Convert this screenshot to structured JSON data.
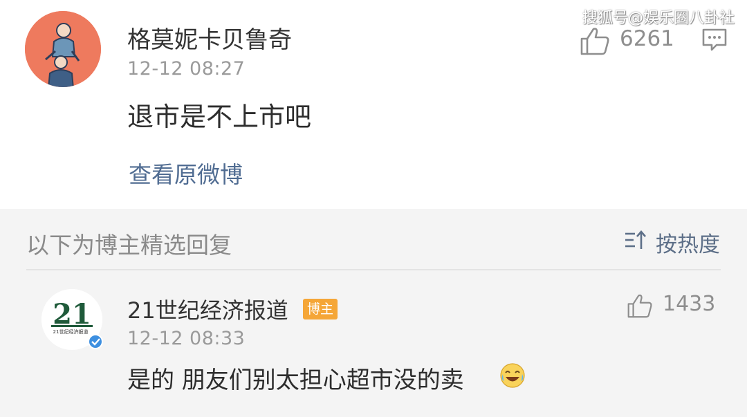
{
  "watermark": "搜狐号@娱乐圈八卦社",
  "comment": {
    "username": "格莫妮卡贝鲁奇",
    "time": "12-12 08:27",
    "content": "退市是不上市吧",
    "like_count": "6261",
    "view_original_label": "查看原微博",
    "avatar_color": "#ee7a5e"
  },
  "replies_section": {
    "title": "以下为博主精选回复",
    "sort_label": "按热度"
  },
  "reply": {
    "username": "21世纪经济报道",
    "badge": "博主",
    "time": "12-12 08:33",
    "content": "是的 朋友们别太担心超市没的卖",
    "like_count": "1433",
    "avatar_text": "21",
    "avatar_subtext": "21世纪经济报道",
    "emoji_icon": "laughing-crying-emoji-icon"
  },
  "colors": {
    "link": "#506c92",
    "badge": "#f5a637",
    "verified": "#3d8fe0",
    "section_bg": "#f4f4f4"
  }
}
